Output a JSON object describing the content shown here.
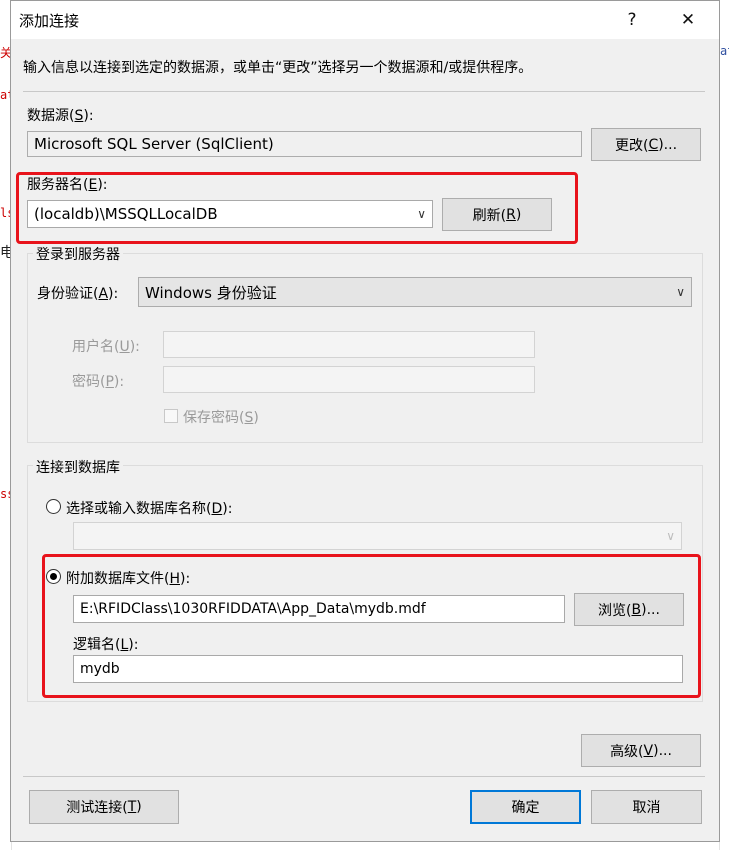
{
  "title_bar": {
    "title": "添加连接",
    "help": "?",
    "close": "✕"
  },
  "description": "输入信息以连接到选定的数据源，或单击“更改”选择另一个数据源和/或提供程序。",
  "data_source": {
    "label_pre": "数据源(",
    "label_key": "S",
    "label_post": "):",
    "value": "Microsoft SQL Server (SqlClient)",
    "change_pre": "更改(",
    "change_key": "C",
    "change_post": ")..."
  },
  "server_name": {
    "label_pre": "服务器名(",
    "label_key": "E",
    "label_post": "):",
    "value": "(localdb)\\MSSQLLocalDB",
    "refresh_pre": "刷新(",
    "refresh_key": "R",
    "refresh_post": ")"
  },
  "login": {
    "group_title": "登录到服务器",
    "auth_label_pre": "身份验证(",
    "auth_label_key": "A",
    "auth_label_post": "):",
    "auth_value": "Windows 身份验证",
    "user_pre": "用户名(",
    "user_key": "U",
    "user_post": "):",
    "pass_pre": "密码(",
    "pass_key": "P",
    "pass_post": "):",
    "save_pre": "保存密码(",
    "save_key": "S",
    "save_post": ")"
  },
  "database": {
    "group_title": "连接到数据库",
    "select_pre": "选择或输入数据库名称(",
    "select_key": "D",
    "select_post": "):",
    "attach_pre": "附加数据库文件(",
    "attach_key": "H",
    "attach_post": "):",
    "file_path": "E:\\RFIDClass\\1030RFIDDATA\\App_Data\\mydb.mdf",
    "browse_pre": "浏览(",
    "browse_key": "B",
    "browse_post": ")...",
    "logical_pre": "逻辑名(",
    "logical_key": "L",
    "logical_post": "):",
    "logical_value": "mydb"
  },
  "advanced": {
    "pre": "高级(",
    "key": "V",
    "post": ")..."
  },
  "test": {
    "pre": "测试连接(",
    "key": "T",
    "post": ")"
  },
  "ok": "确定",
  "cancel": "取消",
  "colors": {
    "highlight": "#e8131b",
    "default_button_border": "#0078d7"
  },
  "background_fragments": [
    {
      "text": "关",
      "color": "#c00"
    },
    {
      "text": "at",
      "color": "#c00"
    },
    {
      "text": "lss",
      "color": "#c00"
    },
    {
      "text": "电",
      "color": "#222"
    },
    {
      "text": "ss",
      "color": "#c00"
    },
    {
      "text": "at",
      "color": "#3050a0"
    }
  ]
}
